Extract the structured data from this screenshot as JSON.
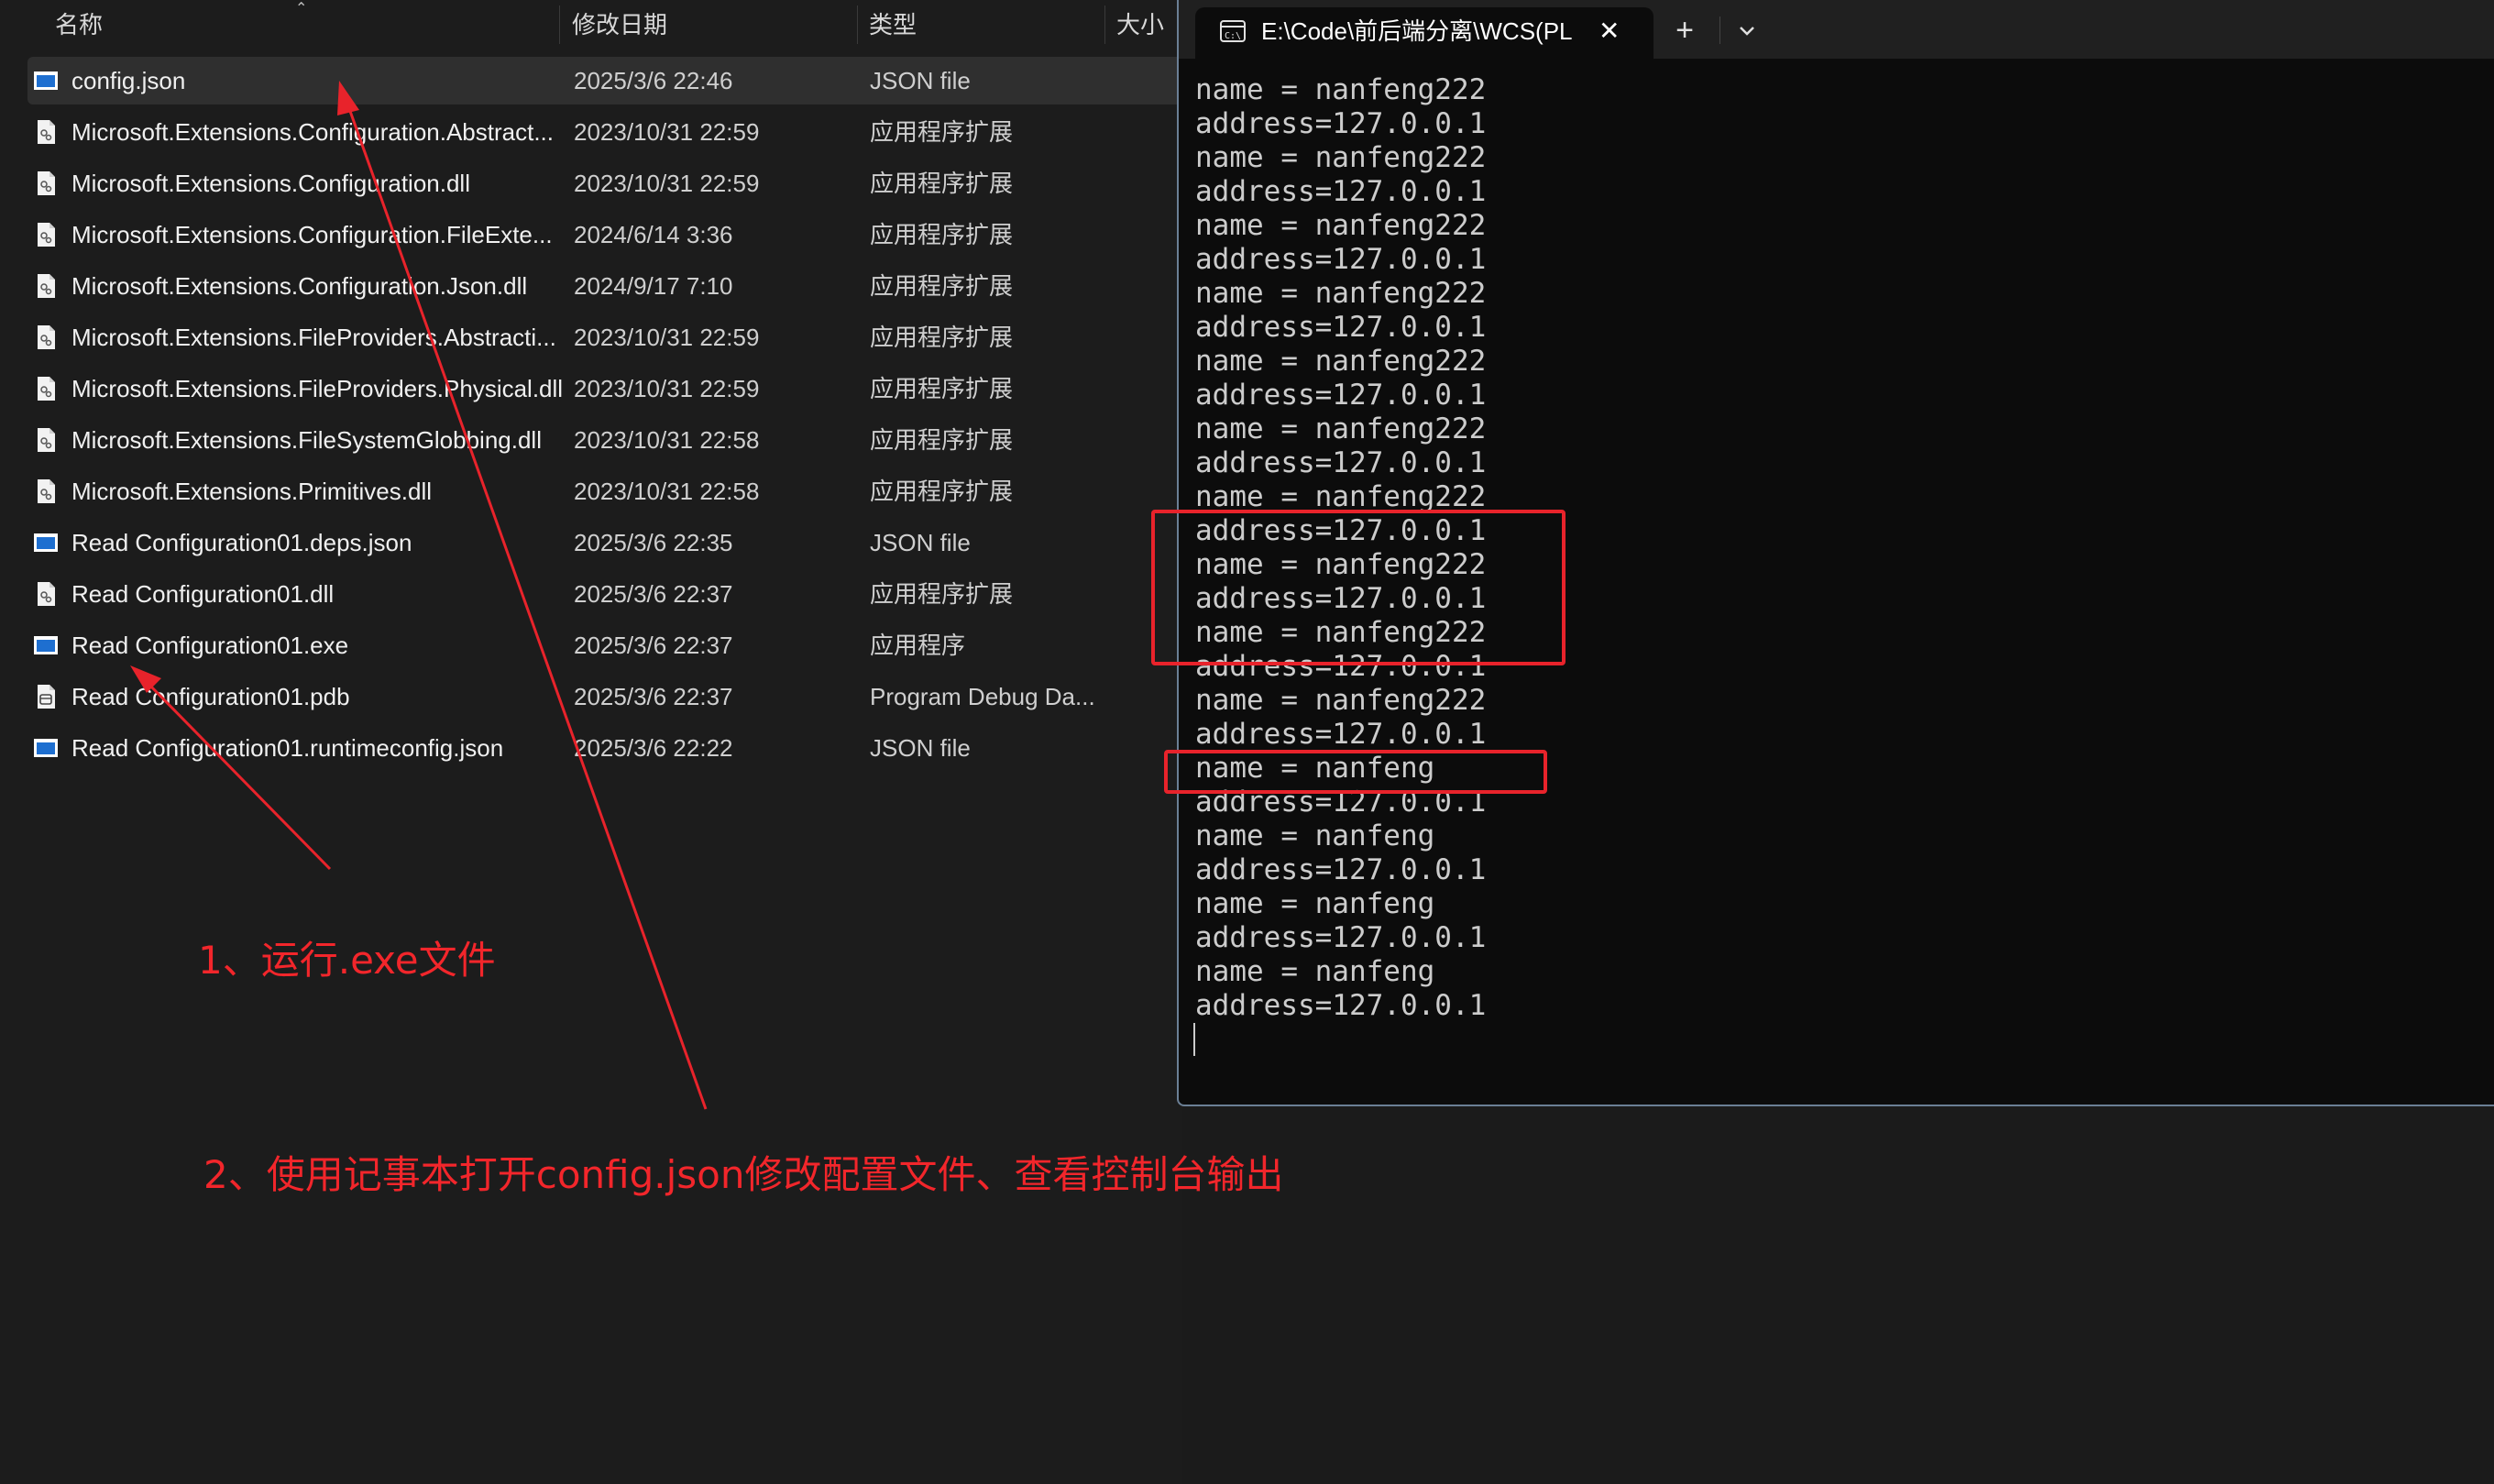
{
  "explorer": {
    "columns": {
      "name": "名称",
      "modified": "修改日期",
      "type": "类型",
      "size": "大小"
    },
    "files": [
      {
        "name": "config.json",
        "modified": "2025/3/6 22:46",
        "type": "JSON file",
        "icon": "json-file-icon",
        "selected": true
      },
      {
        "name": "Microsoft.Extensions.Configuration.Abstract...",
        "modified": "2023/10/31 22:59",
        "type": "应用程序扩展",
        "icon": "dll-file-icon"
      },
      {
        "name": "Microsoft.Extensions.Configuration.dll",
        "modified": "2023/10/31 22:59",
        "type": "应用程序扩展",
        "icon": "dll-file-icon"
      },
      {
        "name": "Microsoft.Extensions.Configuration.FileExte...",
        "modified": "2024/6/14 3:36",
        "type": "应用程序扩展",
        "icon": "dll-file-icon"
      },
      {
        "name": "Microsoft.Extensions.Configuration.Json.dll",
        "modified": "2024/9/17 7:10",
        "type": "应用程序扩展",
        "icon": "dll-file-icon"
      },
      {
        "name": "Microsoft.Extensions.FileProviders.Abstracti...",
        "modified": "2023/10/31 22:59",
        "type": "应用程序扩展",
        "icon": "dll-file-icon"
      },
      {
        "name": "Microsoft.Extensions.FileProviders.Physical.dll",
        "modified": "2023/10/31 22:59",
        "type": "应用程序扩展",
        "icon": "dll-file-icon"
      },
      {
        "name": "Microsoft.Extensions.FileSystemGlobbing.dll",
        "modified": "2023/10/31 22:58",
        "type": "应用程序扩展",
        "icon": "dll-file-icon"
      },
      {
        "name": "Microsoft.Extensions.Primitives.dll",
        "modified": "2023/10/31 22:58",
        "type": "应用程序扩展",
        "icon": "dll-file-icon"
      },
      {
        "name": "Read Configuration01.deps.json",
        "modified": "2025/3/6 22:35",
        "type": "JSON file",
        "icon": "json-file-icon"
      },
      {
        "name": "Read Configuration01.dll",
        "modified": "2025/3/6 22:37",
        "type": "应用程序扩展",
        "icon": "dll-file-icon"
      },
      {
        "name": "Read Configuration01.exe",
        "modified": "2025/3/6 22:37",
        "type": "应用程序",
        "icon": "exe-file-icon"
      },
      {
        "name": "Read Configuration01.pdb",
        "modified": "2025/3/6 22:37",
        "type": "Program Debug Da...",
        "icon": "pdb-file-icon"
      },
      {
        "name": "Read Configuration01.runtimeconfig.json",
        "modified": "2025/3/6 22:22",
        "type": "JSON file",
        "icon": "json-file-icon"
      }
    ]
  },
  "terminal": {
    "tab_title": "E:\\Code\\前后端分离\\WCS(PLC",
    "tab_close": "✕",
    "new_tab": "+",
    "lines": [
      "name = nanfeng222",
      "address=127.0.0.1",
      "name = nanfeng222",
      "address=127.0.0.1",
      "name = nanfeng222",
      "address=127.0.0.1",
      "name = nanfeng222",
      "address=127.0.0.1",
      "name = nanfeng222",
      "address=127.0.0.1",
      "name = nanfeng222",
      "address=127.0.0.1",
      "name = nanfeng222",
      "address=127.0.0.1",
      "name = nanfeng222",
      "address=127.0.0.1",
      "name = nanfeng222",
      "address=127.0.0.1",
      "name = nanfeng222",
      "address=127.0.0.1",
      "name = nanfeng",
      "address=127.0.0.1",
      "name = nanfeng",
      "address=127.0.0.1",
      "name = nanfeng",
      "address=127.0.0.1",
      "name = nanfeng",
      "address=127.0.0.1"
    ]
  },
  "annotations": {
    "step1": "1、运行.exe文件",
    "step2": "2、使用记事本打开config.json修改配置文件、查看控制台输出",
    "color": "#f2262b"
  },
  "colors": {
    "explorer_bg": "#1c1c1c",
    "terminal_bg": "#0c0c0c",
    "selection": "#2f2f2f",
    "annotation_red": "#e8232b"
  }
}
